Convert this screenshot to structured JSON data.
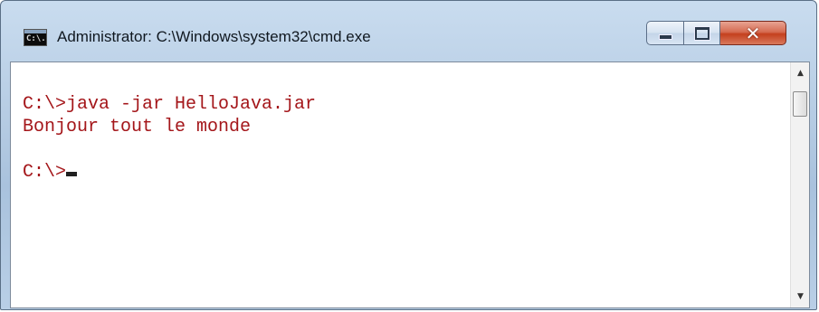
{
  "window": {
    "title": "Administrator: C:\\Windows\\system32\\cmd.exe",
    "app_icon": "cmd-icon",
    "app_icon_text": "C:\\."
  },
  "caption_buttons": {
    "minimize_icon": "minimize-icon",
    "maximize_icon": "maximize-icon",
    "close_icon": "close-icon",
    "close_glyph": "✕"
  },
  "console": {
    "text_color": "#a4161a",
    "lines": [
      "",
      "C:\\>java -jar HelloJava.jar",
      "Bonjour tout le monde",
      "",
      "C:\\>"
    ]
  },
  "scrollbar": {
    "up_arrow": "▲",
    "down_arrow": "▼"
  }
}
